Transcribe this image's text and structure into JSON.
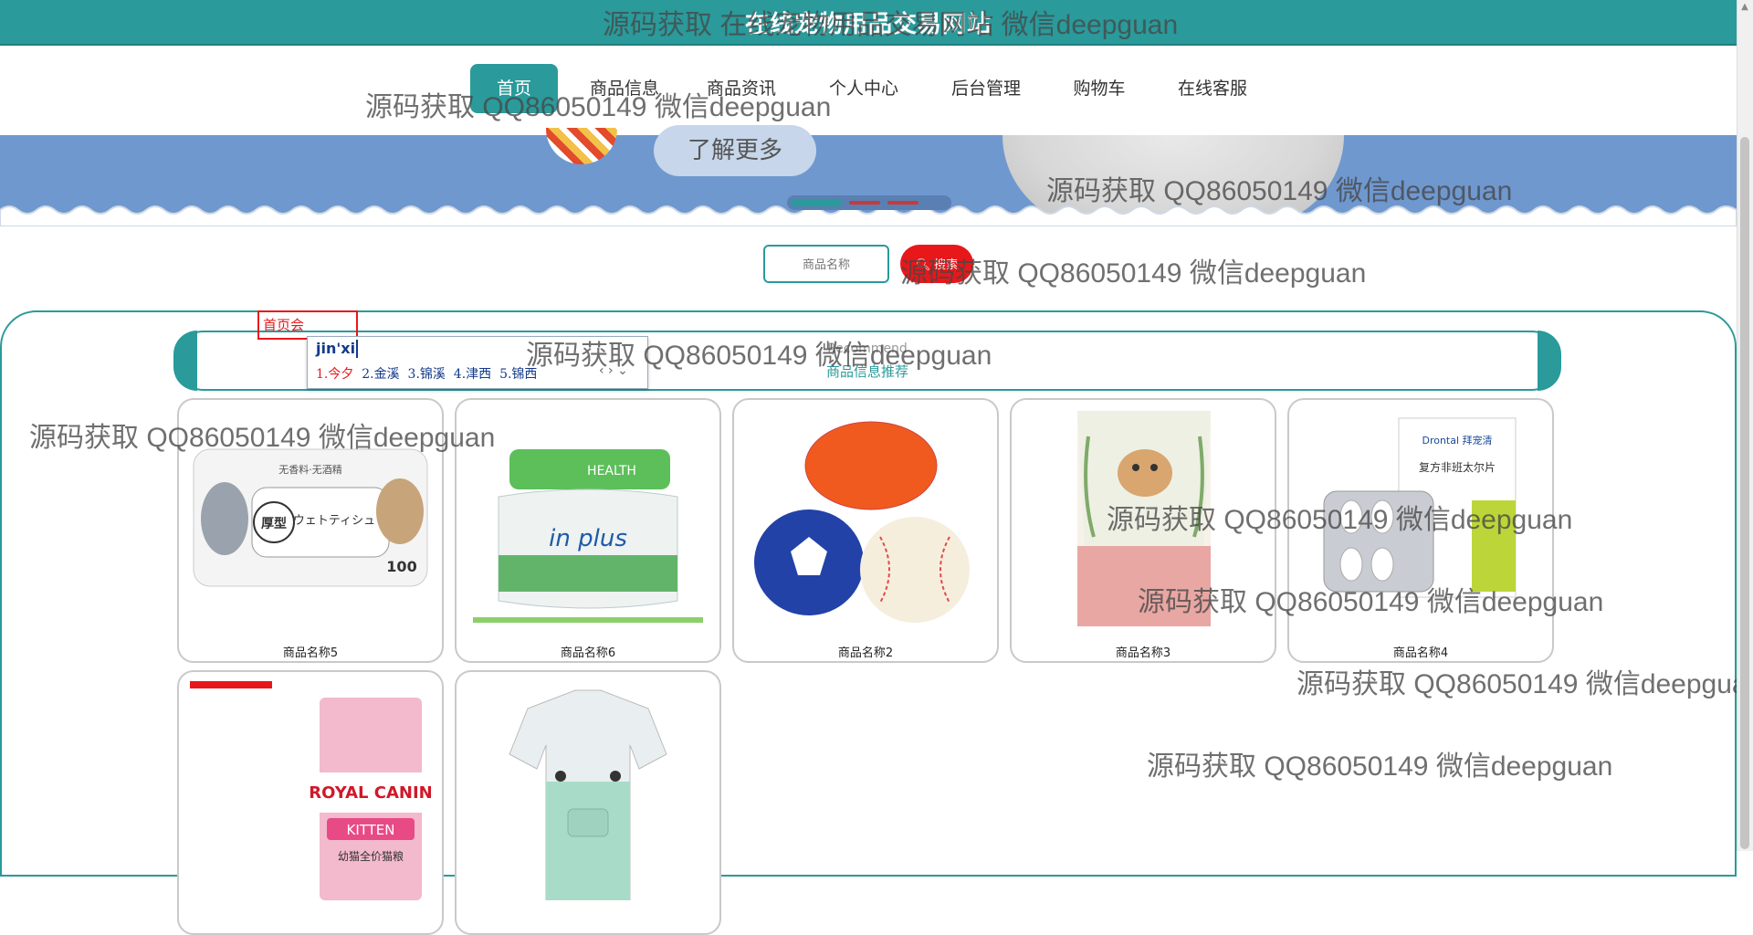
{
  "site": {
    "title": "在线宠物用品交易网站"
  },
  "nav": {
    "items": [
      {
        "label": "首页",
        "active": true
      },
      {
        "label": "商品信息",
        "active": false
      },
      {
        "label": "商品资讯",
        "active": false
      },
      {
        "label": "个人中心",
        "active": false
      },
      {
        "label": "后台管理",
        "active": false
      },
      {
        "label": "购物车",
        "active": false
      },
      {
        "label": "在线客服",
        "active": false
      }
    ]
  },
  "banner": {
    "learn_more": "了解更多"
  },
  "search": {
    "placeholder": "商品名称",
    "button": "搜索",
    "icon": "search-icon"
  },
  "breadcrumb": "首页会",
  "recommend": {
    "en": "Recommend",
    "cn": "商品信息推荐"
  },
  "ime": {
    "input": "jin'xi",
    "candidates": [
      "1.今夕",
      "2.金溪",
      "3.锦溪",
      "4.津西",
      "5.锦西"
    ],
    "arrows": "‹ › ⌄"
  },
  "products": [
    {
      "name": "商品名称5",
      "image": "pet-wipes"
    },
    {
      "name": "商品名称6",
      "image": "probiotic-jar"
    },
    {
      "name": "商品名称2",
      "image": "rubber-balls"
    },
    {
      "name": "商品名称3",
      "image": "hamster-food-bag"
    },
    {
      "name": "商品名称4",
      "image": "dewormer-box"
    },
    {
      "name": "",
      "image": "royal-canin-kitten"
    },
    {
      "name": "",
      "image": "pet-clothing"
    }
  ],
  "image_text": {
    "wipes_brand": "厚型",
    "wipes_jp": "ウェトティシュ",
    "wipes_count": "100",
    "wipes_top": "无香料·无酒精",
    "probiotic_brand": "in plus",
    "probiotic_health": "HEALTH",
    "dewormer_brand": "Drontal 拜宠清",
    "dewormer_name": "复方非班太尔片",
    "royal": "ROYAL CANIN",
    "kitten": "KITTEN",
    "kitten_cn": "幼猫全价猫粮"
  },
  "watermark": {
    "text": "源码获取 QQ86050149 微信deepguan",
    "text_short": "源码获取 在线宠物用品交易网站 微信deepguan"
  },
  "colors": {
    "accent": "#2a9a9b",
    "danger": "#e8171a",
    "banner": "#6f98cf"
  }
}
